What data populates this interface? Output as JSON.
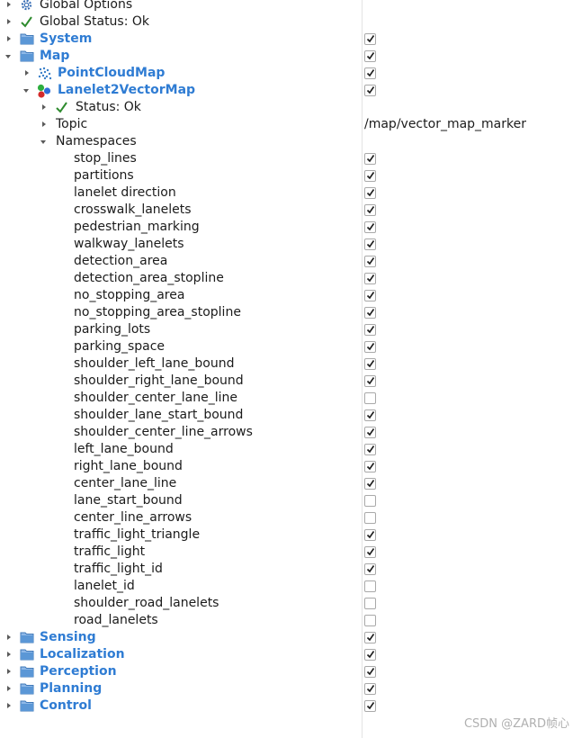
{
  "tree": {
    "global_options": {
      "label": "Global Options"
    },
    "global_status": {
      "label": "Global Status: Ok"
    },
    "system": {
      "label": "System",
      "enabled": true
    },
    "map": {
      "label": "Map",
      "enabled": true,
      "point_cloud_map": {
        "label": "PointCloudMap",
        "enabled": true
      },
      "lanelet2": {
        "label": "Lanelet2VectorMap",
        "enabled": true,
        "status": {
          "label": "Status: Ok"
        },
        "topic": {
          "label": "Topic",
          "value": "/map/vector_map_marker"
        },
        "namespaces": {
          "label": "Namespaces",
          "items": [
            {
              "label": "stop_lines",
              "checked": true
            },
            {
              "label": "partitions",
              "checked": true
            },
            {
              "label": "lanelet direction",
              "checked": true
            },
            {
              "label": "crosswalk_lanelets",
              "checked": true
            },
            {
              "label": "pedestrian_marking",
              "checked": true
            },
            {
              "label": "walkway_lanelets",
              "checked": true
            },
            {
              "label": "detection_area",
              "checked": true
            },
            {
              "label": "detection_area_stopline",
              "checked": true
            },
            {
              "label": "no_stopping_area",
              "checked": true
            },
            {
              "label": "no_stopping_area_stopline",
              "checked": true
            },
            {
              "label": "parking_lots",
              "checked": true
            },
            {
              "label": "parking_space",
              "checked": true
            },
            {
              "label": "shoulder_left_lane_bound",
              "checked": true
            },
            {
              "label": "shoulder_right_lane_bound",
              "checked": true
            },
            {
              "label": "shoulder_center_lane_line",
              "checked": false
            },
            {
              "label": "shoulder_lane_start_bound",
              "checked": true
            },
            {
              "label": "shoulder_center_line_arrows",
              "checked": true
            },
            {
              "label": "left_lane_bound",
              "checked": true
            },
            {
              "label": "right_lane_bound",
              "checked": true
            },
            {
              "label": "center_lane_line",
              "checked": true
            },
            {
              "label": "lane_start_bound",
              "checked": false
            },
            {
              "label": "center_line_arrows",
              "checked": false
            },
            {
              "label": "traffic_light_triangle",
              "checked": true
            },
            {
              "label": "traffic_light",
              "checked": true
            },
            {
              "label": "traffic_light_id",
              "checked": true
            },
            {
              "label": "lanelet_id",
              "checked": false
            },
            {
              "label": "shoulder_road_lanelets",
              "checked": false
            },
            {
              "label": "road_lanelets",
              "checked": false
            }
          ]
        }
      }
    },
    "bottom_groups": [
      {
        "label": "Sensing",
        "enabled": true
      },
      {
        "label": "Localization",
        "enabled": true
      },
      {
        "label": "Perception",
        "enabled": true
      },
      {
        "label": "Planning",
        "enabled": true
      },
      {
        "label": "Control",
        "enabled": true
      }
    ]
  },
  "watermark": "CSDN @ZARD帧心",
  "colors": {
    "group_text": "#2f7cd3",
    "check": "#1b1b1b",
    "status_check": "#2e8b2e",
    "folder": "#4a90d9"
  }
}
